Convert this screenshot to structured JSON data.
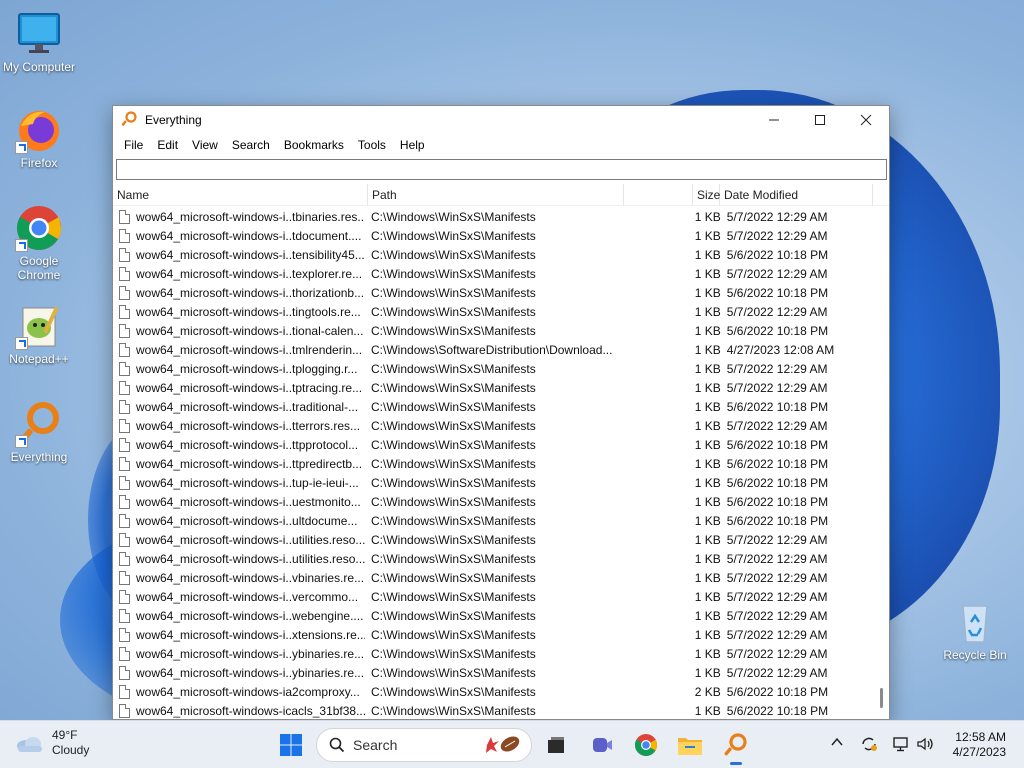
{
  "desktop": {
    "icons": [
      {
        "label": "My Computer",
        "icon": "monitor-icon"
      },
      {
        "label": "Firefox",
        "icon": "firefox-icon"
      },
      {
        "label": "Google Chrome",
        "icon": "chrome-icon"
      },
      {
        "label": "Notepad++",
        "icon": "notepad-plus-plus-icon"
      },
      {
        "label": "Everything",
        "icon": "everything-magnifier-icon"
      },
      {
        "label": "Recycle Bin",
        "icon": "recycle-bin-icon"
      }
    ]
  },
  "window": {
    "title": "Everything",
    "menu": [
      "File",
      "Edit",
      "View",
      "Search",
      "Bookmarks",
      "Tools",
      "Help"
    ],
    "search": {
      "value": "",
      "placeholder": ""
    },
    "columns": {
      "name": "Name",
      "path": "Path",
      "size": "Size",
      "date": "Date Modified"
    },
    "rows": [
      {
        "name": "wow64_microsoft-windows-i..tbinaries.res...",
        "path": "C:\\Windows\\WinSxS\\Manifests",
        "size": "1 KB",
        "date": "5/7/2022 12:29 AM"
      },
      {
        "name": "wow64_microsoft-windows-i..tdocument....",
        "path": "C:\\Windows\\WinSxS\\Manifests",
        "size": "1 KB",
        "date": "5/7/2022 12:29 AM"
      },
      {
        "name": "wow64_microsoft-windows-i..tensibility45...",
        "path": "C:\\Windows\\WinSxS\\Manifests",
        "size": "1 KB",
        "date": "5/6/2022 10:18 PM"
      },
      {
        "name": "wow64_microsoft-windows-i..texplorer.re...",
        "path": "C:\\Windows\\WinSxS\\Manifests",
        "size": "1 KB",
        "date": "5/7/2022 12:29 AM"
      },
      {
        "name": "wow64_microsoft-windows-i..thorizationb...",
        "path": "C:\\Windows\\WinSxS\\Manifests",
        "size": "1 KB",
        "date": "5/6/2022 10:18 PM"
      },
      {
        "name": "wow64_microsoft-windows-i..tingtools.re...",
        "path": "C:\\Windows\\WinSxS\\Manifests",
        "size": "1 KB",
        "date": "5/7/2022 12:29 AM"
      },
      {
        "name": "wow64_microsoft-windows-i..tional-calen...",
        "path": "C:\\Windows\\WinSxS\\Manifests",
        "size": "1 KB",
        "date": "5/6/2022 10:18 PM"
      },
      {
        "name": "wow64_microsoft-windows-i..tmlrenderin...",
        "path": "C:\\Windows\\SoftwareDistribution\\Download...",
        "size": "1 KB",
        "date": "4/27/2023 12:08 AM"
      },
      {
        "name": "wow64_microsoft-windows-i..tplogging.r...",
        "path": "C:\\Windows\\WinSxS\\Manifests",
        "size": "1 KB",
        "date": "5/7/2022 12:29 AM"
      },
      {
        "name": "wow64_microsoft-windows-i..tptracing.re...",
        "path": "C:\\Windows\\WinSxS\\Manifests",
        "size": "1 KB",
        "date": "5/7/2022 12:29 AM"
      },
      {
        "name": "wow64_microsoft-windows-i..traditional-...",
        "path": "C:\\Windows\\WinSxS\\Manifests",
        "size": "1 KB",
        "date": "5/6/2022 10:18 PM"
      },
      {
        "name": "wow64_microsoft-windows-i..tterrors.res...",
        "path": "C:\\Windows\\WinSxS\\Manifests",
        "size": "1 KB",
        "date": "5/7/2022 12:29 AM"
      },
      {
        "name": "wow64_microsoft-windows-i..ttpprotocol...",
        "path": "C:\\Windows\\WinSxS\\Manifests",
        "size": "1 KB",
        "date": "5/6/2022 10:18 PM"
      },
      {
        "name": "wow64_microsoft-windows-i..ttpredirectb...",
        "path": "C:\\Windows\\WinSxS\\Manifests",
        "size": "1 KB",
        "date": "5/6/2022 10:18 PM"
      },
      {
        "name": "wow64_microsoft-windows-i..tup-ie-ieui-...",
        "path": "C:\\Windows\\WinSxS\\Manifests",
        "size": "1 KB",
        "date": "5/6/2022 10:18 PM"
      },
      {
        "name": "wow64_microsoft-windows-i..uestmonito...",
        "path": "C:\\Windows\\WinSxS\\Manifests",
        "size": "1 KB",
        "date": "5/6/2022 10:18 PM"
      },
      {
        "name": "wow64_microsoft-windows-i..ultdocume...",
        "path": "C:\\Windows\\WinSxS\\Manifests",
        "size": "1 KB",
        "date": "5/6/2022 10:18 PM"
      },
      {
        "name": "wow64_microsoft-windows-i..utilities.reso...",
        "path": "C:\\Windows\\WinSxS\\Manifests",
        "size": "1 KB",
        "date": "5/7/2022 12:29 AM"
      },
      {
        "name": "wow64_microsoft-windows-i..utilities.reso...",
        "path": "C:\\Windows\\WinSxS\\Manifests",
        "size": "1 KB",
        "date": "5/7/2022 12:29 AM"
      },
      {
        "name": "wow64_microsoft-windows-i..vbinaries.re...",
        "path": "C:\\Windows\\WinSxS\\Manifests",
        "size": "1 KB",
        "date": "5/7/2022 12:29 AM"
      },
      {
        "name": "wow64_microsoft-windows-i..vercommo...",
        "path": "C:\\Windows\\WinSxS\\Manifests",
        "size": "1 KB",
        "date": "5/7/2022 12:29 AM"
      },
      {
        "name": "wow64_microsoft-windows-i..webengine....",
        "path": "C:\\Windows\\WinSxS\\Manifests",
        "size": "1 KB",
        "date": "5/7/2022 12:29 AM"
      },
      {
        "name": "wow64_microsoft-windows-i..xtensions.re...",
        "path": "C:\\Windows\\WinSxS\\Manifests",
        "size": "1 KB",
        "date": "5/7/2022 12:29 AM"
      },
      {
        "name": "wow64_microsoft-windows-i..ybinaries.re...",
        "path": "C:\\Windows\\WinSxS\\Manifests",
        "size": "1 KB",
        "date": "5/7/2022 12:29 AM"
      },
      {
        "name": "wow64_microsoft-windows-i..ybinaries.re...",
        "path": "C:\\Windows\\WinSxS\\Manifests",
        "size": "1 KB",
        "date": "5/7/2022 12:29 AM"
      },
      {
        "name": "wow64_microsoft-windows-ia2comproxy...",
        "path": "C:\\Windows\\WinSxS\\Manifests",
        "size": "2 KB",
        "date": "5/6/2022 10:18 PM"
      },
      {
        "name": "wow64_microsoft-windows-icacls_31bf38...",
        "path": "C:\\Windows\\WinSxS\\Manifests",
        "size": "1 KB",
        "date": "5/6/2022 10:18 PM"
      }
    ]
  },
  "taskbar": {
    "weather": {
      "temp": "49°F",
      "condition": "Cloudy"
    },
    "search_label": "Search",
    "pinned": [
      "windows-start-icon",
      "task-view-icon",
      "meet-icon",
      "chrome-icon",
      "file-explorer-icon",
      "everything-magnifier-icon"
    ],
    "time": "12:58 AM",
    "date": "4/27/2023"
  },
  "colors": {
    "accent": "#2a6fdb",
    "everything_orange": "#e8801a"
  }
}
